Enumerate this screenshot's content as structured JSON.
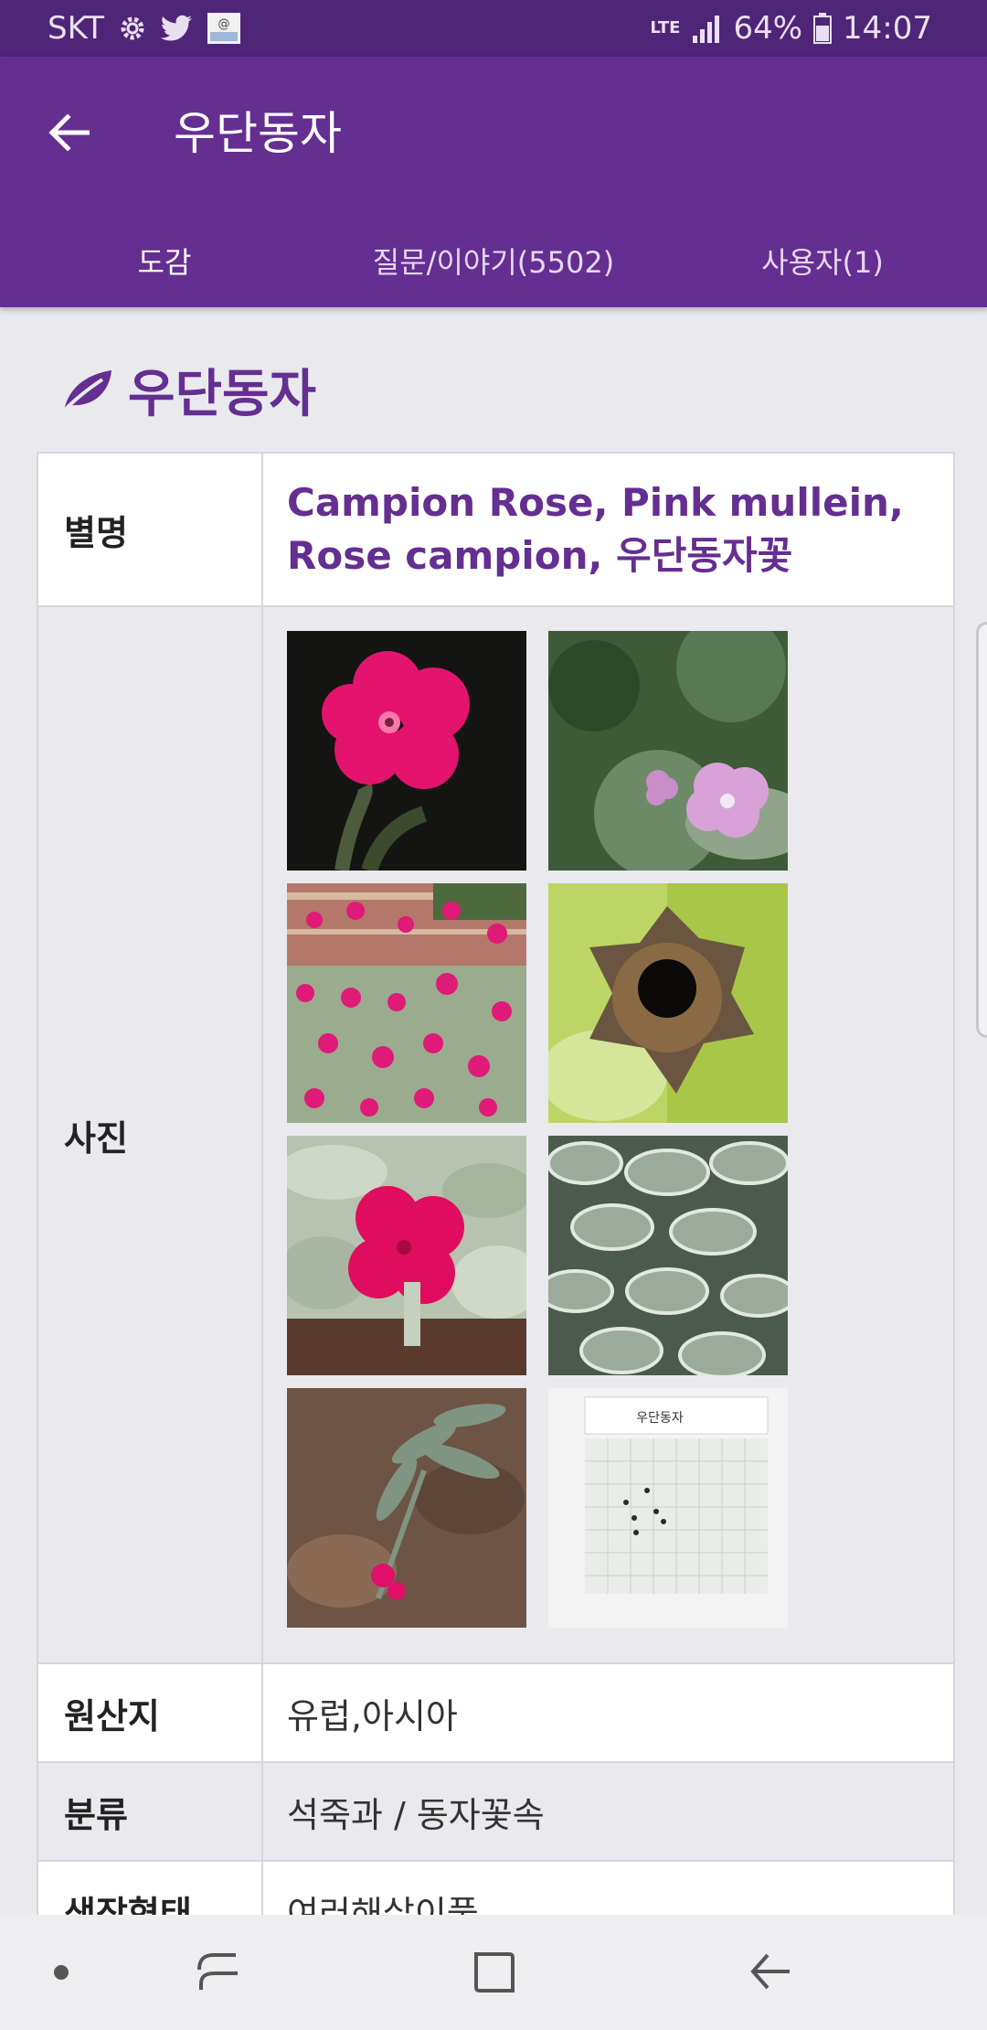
{
  "status": {
    "carrier": "SKT",
    "network": "LTE",
    "battery": "64%",
    "time": "14:07"
  },
  "appbar": {
    "title": "우단동자",
    "tabs": [
      {
        "label": "도감"
      },
      {
        "label": "질문/이야기(5502)"
      },
      {
        "label": "사용자(1)"
      }
    ]
  },
  "heading": "우단동자",
  "table": {
    "alias_label": "별명",
    "alias_value": "Campion Rose, Pink mullein, Rose campion, 우단동자꽃",
    "photo_label": "사진",
    "origin_label": "원산지",
    "origin_value": "유럽,아시아",
    "class_label": "분류",
    "class_value": "석죽과 / 동자꽃속",
    "form_label": "생장형태",
    "form_value": "여러해살이풀"
  },
  "photos": [
    {
      "icon": "magenta-flower-dark-photo"
    },
    {
      "icon": "pale-pink-flower-photo"
    },
    {
      "icon": "flower-bed-photo"
    },
    {
      "icon": "seed-pod-photo"
    },
    {
      "icon": "magenta-flower-leaves-photo"
    },
    {
      "icon": "silver-leaves-photo"
    },
    {
      "icon": "plant-soil-photo"
    },
    {
      "icon": "seed-card-photo"
    }
  ],
  "seed_card_label": "우단동자",
  "colors": {
    "status_bar": "#4f2578",
    "app_bar": "#652e91",
    "accent_text": "#652e91",
    "background": "#e9e9ee"
  }
}
